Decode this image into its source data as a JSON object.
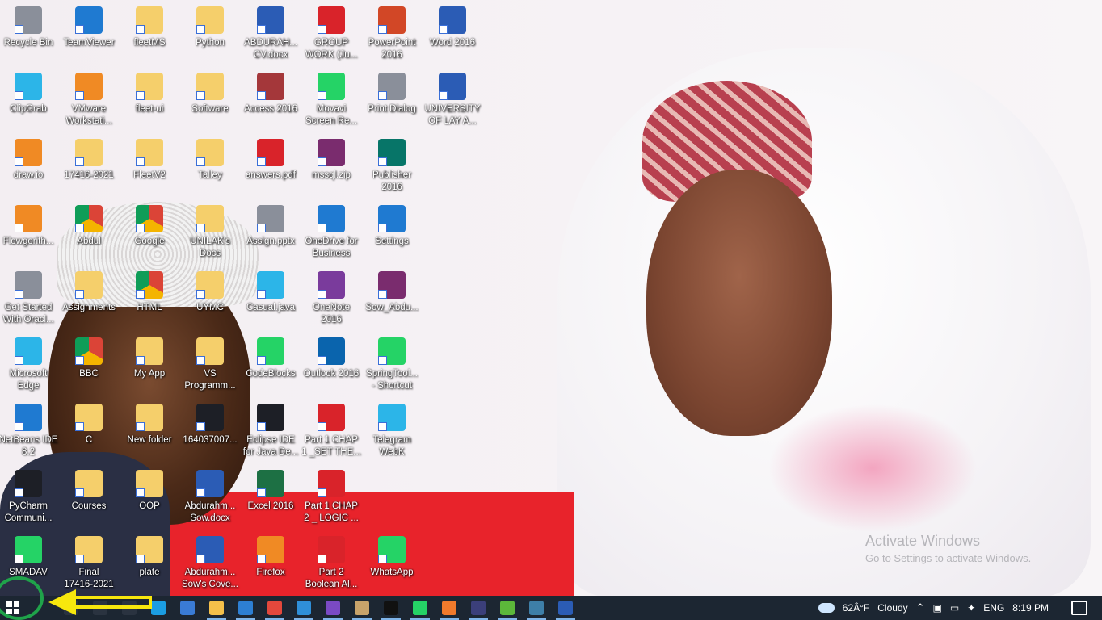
{
  "desktop": {
    "icons": [
      {
        "label": "Recycle Bin",
        "icon": "recycle-bin-icon",
        "style": "g-gray"
      },
      {
        "label": "TeamViewer",
        "icon": "teamviewer-icon",
        "style": "g-blue"
      },
      {
        "label": "fleetMS",
        "icon": "folder-icon",
        "style": "g-folder"
      },
      {
        "label": "Python",
        "icon": "folder-icon",
        "style": "g-folder"
      },
      {
        "label": "ABDURAH...\nCV.docx",
        "icon": "word-document-icon",
        "style": "g-word"
      },
      {
        "label": "GROUP\nWORK (Ju...",
        "icon": "pdf-icon",
        "style": "g-pdf"
      },
      {
        "label": "PowerPoint\n2016",
        "icon": "powerpoint-icon",
        "style": "g-ppt"
      },
      {
        "label": "Word 2016",
        "icon": "word-icon",
        "style": "g-word"
      },
      {
        "label": "ClipGrab",
        "icon": "clipgrab-icon",
        "style": "g-teal"
      },
      {
        "label": "VMware\nWorkstati...",
        "icon": "vmware-icon",
        "style": "g-orange"
      },
      {
        "label": "fleet-ui",
        "icon": "folder-icon",
        "style": "g-folder"
      },
      {
        "label": "Software",
        "icon": "folder-icon",
        "style": "g-folder"
      },
      {
        "label": "Access 2016",
        "icon": "access-icon",
        "style": "g-access"
      },
      {
        "label": "Movavi\nScreen Re...",
        "icon": "movavi-icon",
        "style": "g-green"
      },
      {
        "label": "Print Dialog",
        "icon": "printer-icon",
        "style": "g-gray"
      },
      {
        "label": "UNIVERSITY\nOF LAY A...",
        "icon": "word-document-icon",
        "style": "g-word"
      },
      {
        "label": "draw.io",
        "icon": "drawio-icon",
        "style": "g-orange"
      },
      {
        "label": "17416-2021",
        "icon": "folder-icon",
        "style": "g-folder"
      },
      {
        "label": "FleetV2",
        "icon": "folder-icon",
        "style": "g-folder"
      },
      {
        "label": "Talley",
        "icon": "folder-icon",
        "style": "g-folder"
      },
      {
        "label": "answers.pdf",
        "icon": "pdf-icon",
        "style": "g-pdf"
      },
      {
        "label": "mssql.zip",
        "icon": "archive-icon",
        "style": "g-rar"
      },
      {
        "label": "Publisher\n2016",
        "icon": "publisher-icon",
        "style": "g-pub"
      },
      {
        "label": "Flowgorith...",
        "icon": "flowgorithm-icon",
        "style": "g-orange"
      },
      {
        "label": "Abdul",
        "icon": "chrome-icon",
        "style": "g-chrome"
      },
      {
        "label": "Google",
        "icon": "chrome-icon",
        "style": "g-chrome"
      },
      {
        "label": "UNILAK's\nDocs",
        "icon": "folder-icon",
        "style": "g-folder"
      },
      {
        "label": "Assign.pptx",
        "icon": "pptx-file-icon",
        "style": "g-gray"
      },
      {
        "label": "OneDrive for\nBusiness",
        "icon": "onedrive-icon",
        "style": "g-blue"
      },
      {
        "label": "Settings",
        "icon": "gear-icon",
        "style": "g-blue"
      },
      {
        "label": "Get Started\nWith Oracl...",
        "icon": "oracle-database-icon",
        "style": "g-gray"
      },
      {
        "label": "Assignments",
        "icon": "folder-icon",
        "style": "g-folder"
      },
      {
        "label": "HTML",
        "icon": "chrome-icon",
        "style": "g-chrome"
      },
      {
        "label": "UYMC",
        "icon": "folder-icon",
        "style": "g-folder"
      },
      {
        "label": "Casual.java",
        "icon": "java-file-icon",
        "style": "g-teal"
      },
      {
        "label": "OneNote\n2016",
        "icon": "onenote-icon",
        "style": "g-onenote"
      },
      {
        "label": "Sow_Abdu...",
        "icon": "archive-icon",
        "style": "g-rar"
      },
      {
        "label": "Microsoft\nEdge",
        "icon": "edge-icon",
        "style": "g-teal"
      },
      {
        "label": "BBC",
        "icon": "chrome-icon",
        "style": "g-chrome"
      },
      {
        "label": "My App",
        "icon": "folder-icon",
        "style": "g-folder"
      },
      {
        "label": "VS\nProgramm...",
        "icon": "folder-icon",
        "style": "g-folder"
      },
      {
        "label": "CodeBlocks",
        "icon": "codeblocks-icon",
        "style": "g-green"
      },
      {
        "label": "Outlook 2016",
        "icon": "outlook-icon",
        "style": "g-outlook"
      },
      {
        "label": "SpringTool...\n- Shortcut",
        "icon": "springtool-icon",
        "style": "g-green"
      },
      {
        "label": "NetBeans IDE\n8.2",
        "icon": "netbeans-icon",
        "style": "g-blue"
      },
      {
        "label": "C",
        "icon": "folder-icon",
        "style": "g-folder"
      },
      {
        "label": "New folder",
        "icon": "folder-icon",
        "style": "g-folder"
      },
      {
        "label": "164037007...",
        "icon": "image-file-icon",
        "style": "g-dark"
      },
      {
        "label": "Eclipse IDE\nfor Java De...",
        "icon": "eclipse-icon",
        "style": "g-dark"
      },
      {
        "label": "Part 1 CHAP\n1 _SET THE...",
        "icon": "pdf-icon",
        "style": "g-pdf"
      },
      {
        "label": "Telegram\nWebK",
        "icon": "telegram-icon",
        "style": "g-teal"
      },
      {
        "label": "PyCharm\nCommuni...",
        "icon": "pycharm-icon",
        "style": "g-dark"
      },
      {
        "label": "Courses",
        "icon": "folder-icon",
        "style": "g-folder"
      },
      {
        "label": "OOP",
        "icon": "folder-icon",
        "style": "g-folder"
      },
      {
        "label": "Abdurahm...\nSow.docx",
        "icon": "word-document-icon",
        "style": "g-word"
      },
      {
        "label": "Excel 2016",
        "icon": "excel-icon",
        "style": "g-excel"
      },
      {
        "label": "Part 1 CHAP\n2 _ LOGIC ...",
        "icon": "pdf-icon",
        "style": "g-pdf"
      },
      {
        "label": "SMADAV",
        "icon": "smadav-icon",
        "style": "g-green"
      },
      {
        "label": "Final\n17416-2021",
        "icon": "folder-icon",
        "style": "g-folder"
      },
      {
        "label": "plate",
        "icon": "folder-icon",
        "style": "g-folder"
      },
      {
        "label": "Abdurahm...\nSow's Cove...",
        "icon": "word-document-icon",
        "style": "g-word"
      },
      {
        "label": "Firefox",
        "icon": "firefox-icon",
        "style": "g-orange"
      },
      {
        "label": "Part 2\nBoolean Al...",
        "icon": "pdf-icon",
        "style": "g-pdf"
      },
      {
        "label": "WhatsApp",
        "icon": "whatsapp-icon",
        "style": "g-green"
      }
    ]
  },
  "watermark": {
    "title": "Activate Windows",
    "subtitle": "Go to Settings to activate Windows."
  },
  "taskbar": {
    "pinned": [
      {
        "icon": "search-icon",
        "color": "#2a3340"
      },
      {
        "icon": "cortana-icon",
        "color": "#2a3340"
      },
      {
        "icon": "task-view-icon",
        "color": "#2a3340"
      },
      {
        "icon": "edge-icon",
        "color": "#1b9de2"
      },
      {
        "icon": "store-icon",
        "color": "#3a7bd5"
      },
      {
        "icon": "file-explorer-icon",
        "color": "#f5c04a"
      },
      {
        "icon": "mail-icon",
        "color": "#2d7fd3"
      },
      {
        "icon": "chrome-icon",
        "color": "#e4483c"
      },
      {
        "icon": "vscode-icon",
        "color": "#2f8fd8"
      },
      {
        "icon": "visual-studio-icon",
        "color": "#7b4ac4"
      },
      {
        "icon": "gimp-icon",
        "color": "#c8a36a"
      },
      {
        "icon": "intellij-icon",
        "color": "#111111"
      },
      {
        "icon": "whatsapp-icon",
        "color": "#25d366"
      },
      {
        "icon": "xampp-icon",
        "color": "#f07a2c"
      },
      {
        "icon": "eclipse-icon",
        "color": "#3b3f7a"
      },
      {
        "icon": "springtool-icon",
        "color": "#5cb83a"
      },
      {
        "icon": "mysql-workbench-icon",
        "color": "#3e7fa8"
      },
      {
        "icon": "word-icon",
        "color": "#2b5cb5"
      }
    ],
    "tray": {
      "weather_temp": "62Â°F",
      "weather_text": "Cloudy",
      "language": "ENG",
      "time": "8:19 PM"
    }
  }
}
